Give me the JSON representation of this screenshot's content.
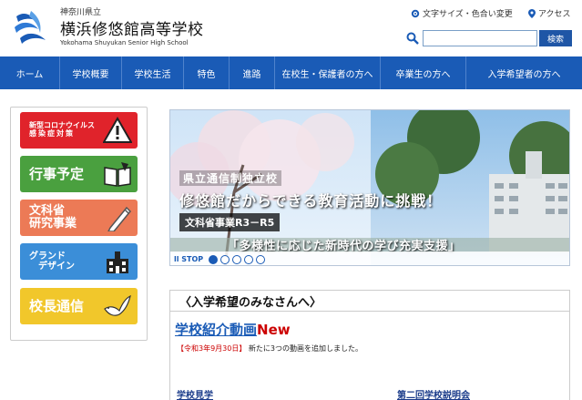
{
  "header": {
    "prefecture": "神奈川県立",
    "school_name": "横浜修悠館高等学校",
    "school_name_en": "Yokohama Shuyukan Senior High School",
    "font_color_label": "文字サイズ・色合い変更",
    "access_label": "アクセス",
    "search_placeholder": "",
    "search_button": "検索"
  },
  "nav": {
    "items": [
      {
        "label": "ホーム"
      },
      {
        "label": "学校概要"
      },
      {
        "label": "学校生活"
      },
      {
        "label": "特色"
      },
      {
        "label": "進路"
      },
      {
        "label": "在校生・保護者の方へ"
      },
      {
        "label": "卒業生の方へ"
      },
      {
        "label": "入学希望者の方へ"
      }
    ]
  },
  "side": {
    "btn1_line1": "新型コロナウイルス",
    "btn1_line2": "感染症対策",
    "btn2": "行事予定",
    "btn3_line1": "文科省",
    "btn3_line2": "研究事業",
    "btn4_line1": "グランド",
    "btn4_line2": "デザイン",
    "btn5": "校長通信"
  },
  "slide": {
    "line1": "県立通信制独立校",
    "line2": "修悠館だからできる教育活動に挑戦！",
    "line3": "文科省事業R3－R5",
    "line4": "「多様性に応じた新時代の学び充実支援」",
    "stop_label": "STOP"
  },
  "content": {
    "section_title": "〈入学希望のみなさんへ〉",
    "video_link": "学校紹介動画",
    "video_new": "New",
    "news_date": "【令和3年9月30日】",
    "news_text": "新たに3つの動画を追加しました。",
    "link_left": "学校見学",
    "link_right": "第二回学校説明会"
  },
  "colors": {
    "nav_bg": "#1a5bb6",
    "accent": "#1a5bb6",
    "new_red": "#cc0000"
  }
}
